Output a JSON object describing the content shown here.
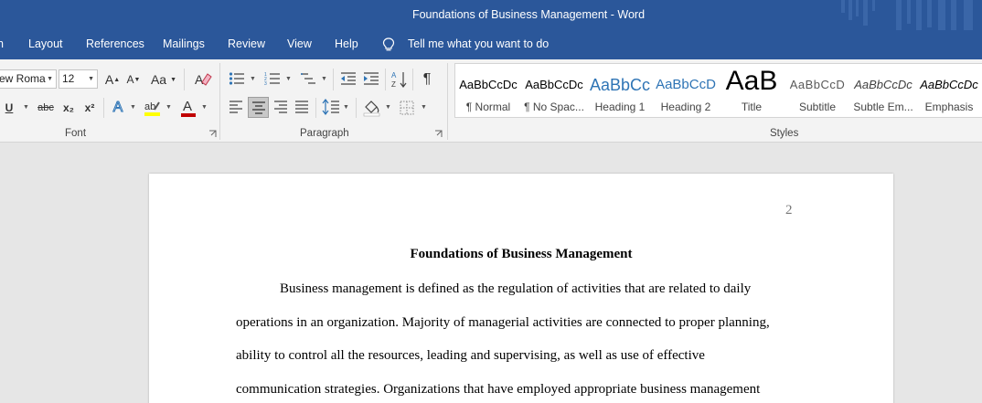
{
  "window": {
    "title": "Foundations of Business Management  -  Word"
  },
  "menu": {
    "items": [
      "n",
      "Layout",
      "References",
      "Mailings",
      "Review",
      "View",
      "Help"
    ],
    "tell_me": "Tell me what you want to do"
  },
  "ribbon": {
    "font": {
      "name": "ew Roma",
      "size": "12",
      "grow_label": "A",
      "shrink_label": "A",
      "case_label": "Aa",
      "underline_label": "U",
      "strike_label": "abc",
      "subscript_label": "x₂",
      "superscript_label": "x²",
      "text_effects_label": "A",
      "font_color_label": "A",
      "group_label": "Font"
    },
    "paragraph": {
      "group_label": "Paragraph",
      "pilcrow": "¶"
    },
    "styles": {
      "group_label": "Styles",
      "items": [
        {
          "preview": "AaBbCcDc",
          "name": "¶ Normal"
        },
        {
          "preview": "AaBbCcDc",
          "name": "¶ No Spac..."
        },
        {
          "preview": "AaBbCc",
          "name": "Heading 1"
        },
        {
          "preview": "AaBbCcD",
          "name": "Heading 2"
        },
        {
          "preview": "AaB",
          "name": "Title"
        },
        {
          "preview": "AaBbCcD",
          "name": "Subtitle"
        },
        {
          "preview": "AaBbCcDc",
          "name": "Subtle Em..."
        },
        {
          "preview": "AaBbCcDc",
          "name": "Emphasis"
        }
      ]
    }
  },
  "document": {
    "page_number": "2",
    "title": "Foundations of Business Management",
    "lines": [
      "Business management is defined as the regulation of activities that are related to daily",
      "operations in an organization. Majority of managerial activities are connected to proper planning,",
      "ability to control all the resources, leading and supervising, as well as use of effective",
      "communication strategies. Organizations that have employed appropriate business management"
    ]
  },
  "colors": {
    "titlebar": "#2b579a",
    "ribbon": "#f3f3f3",
    "heading_blue": "#2e74b5",
    "font_color_red": "#c00000",
    "highlight_yellow": "#ffff00"
  }
}
